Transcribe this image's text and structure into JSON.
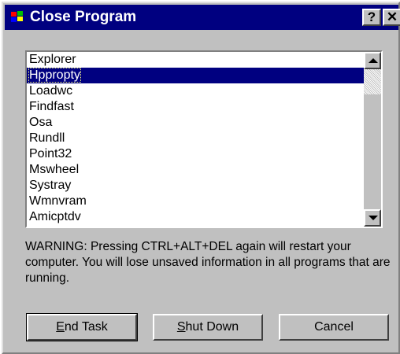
{
  "window": {
    "title": "Close Program",
    "help_label": "?",
    "close_label": "✕"
  },
  "program_list": {
    "selected_index": 1,
    "items": [
      "Explorer",
      "Hppropty",
      "Loadwc",
      "Findfast",
      "Osa",
      "Rundll",
      "Point32",
      "Mswheel",
      "Systray",
      "Wmnvram",
      "Amicptdv"
    ]
  },
  "warning_text": "WARNING: Pressing CTRL+ALT+DEL again will restart your computer. You will lose unsaved information in all programs that are running.",
  "buttons": {
    "end_task": {
      "mnemonic": "E",
      "rest": "nd Task"
    },
    "shut_down": {
      "mnemonic": "S",
      "rest": "hut Down"
    },
    "cancel": "Cancel"
  },
  "colors": {
    "titlebar": "#000080",
    "face": "#c0c0c0",
    "selection": "#000080"
  }
}
